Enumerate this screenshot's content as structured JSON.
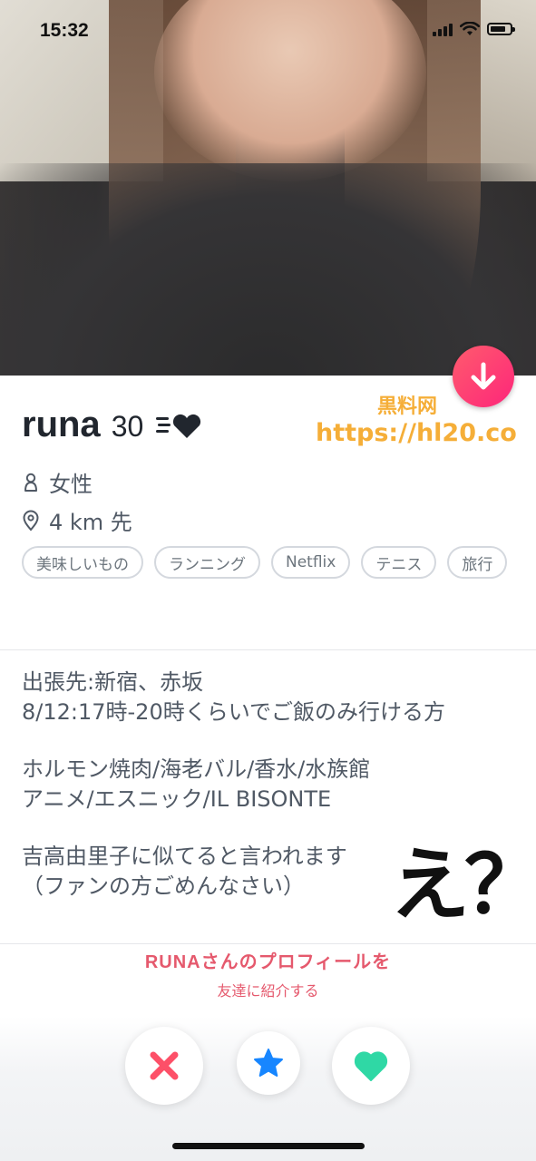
{
  "status_bar": {
    "time": "15:32"
  },
  "profile": {
    "name": "runa",
    "age": "30",
    "gender": "女性",
    "distance": "4 km 先",
    "interests": [
      "美味しいもの",
      "ランニング",
      "Netflix",
      "テニス",
      "旅行"
    ]
  },
  "bio": {
    "lines": [
      "出張先:新宿、赤坂\n8/12:17時-20時くらいでご飯のみ行ける方",
      "ホルモン焼肉/海老バル/香水/水族館\nアニメ/エスニック/IL BISONTE",
      "吉高由里子に似てると言われます\n（ファンの方ごめんなさい）"
    ]
  },
  "watermark": {
    "line1": "黒料网",
    "line2": "https://hl20.co"
  },
  "annotation": "え？",
  "share": {
    "title": "RUNAさんのプロフィールを",
    "subtitle": "友達に紹介する"
  },
  "icons": {
    "down": "arrow-down-icon",
    "gender": "person-icon",
    "location": "location-pin-icon",
    "nope": "close-icon",
    "superlike": "star-icon",
    "like": "heart-icon"
  },
  "colors": {
    "accent": "#fd267a",
    "nope": "#fd5068",
    "star": "#1786ff",
    "like": "#2fd8a5"
  }
}
